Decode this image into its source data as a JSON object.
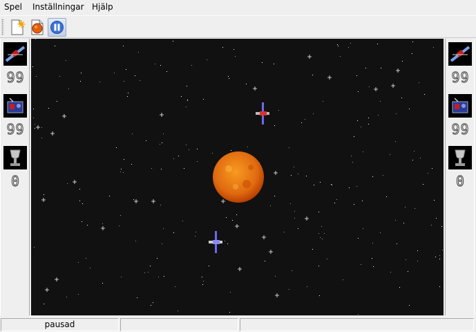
{
  "menu": [
    {
      "label": "Spel",
      "accel": "p"
    },
    {
      "label": "Inställningar",
      "accel": "I"
    },
    {
      "label": "Hjälp",
      "accel": "H"
    }
  ],
  "toolbar": {
    "buttons": [
      {
        "name": "new-game",
        "icon": "new-document-icon"
      },
      {
        "name": "new-round",
        "icon": "round-sun-document-icon"
      },
      {
        "name": "pause",
        "icon": "pause-icon",
        "pressed": true
      }
    ]
  },
  "left_panel": {
    "energy": "99",
    "mines": "99",
    "wins": "0"
  },
  "right_panel": {
    "energy": "99",
    "mines": "99",
    "wins": "0"
  },
  "status": {
    "fields": [
      "pausad",
      "",
      ""
    ]
  },
  "colors": {
    "space": "#111111",
    "sun_core": "#f07a10",
    "sun_edge": "#d04a00",
    "ship_red_accent": "#e03030",
    "ship_blue": "#4a4ae0"
  }
}
